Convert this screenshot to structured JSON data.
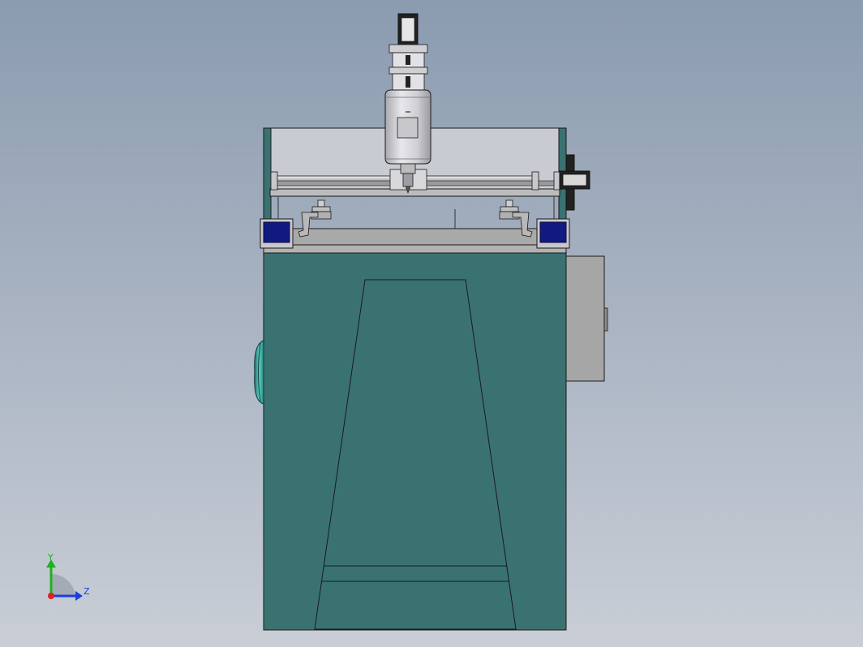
{
  "view": {
    "background_top": "#8b9bb0",
    "background_bottom": "#c9ced6"
  },
  "colors": {
    "body_teal": "#3a7272",
    "edge": "#1a1a1a",
    "panel_gray": "#a9a9a9",
    "light_gray": "#c8c8cc",
    "spindle_silver": "#d2d2d6",
    "navy_block": "#101a80",
    "dark": "#222222",
    "cyan_wheel": "#3fb3a8"
  },
  "triad": {
    "y_label": "Y",
    "z_label": "Z",
    "y_color": "#1db31d",
    "z_color": "#1e3de0",
    "x_color": "#e02020"
  },
  "icons": {
    "triad": "coordinate-triad-icon"
  }
}
